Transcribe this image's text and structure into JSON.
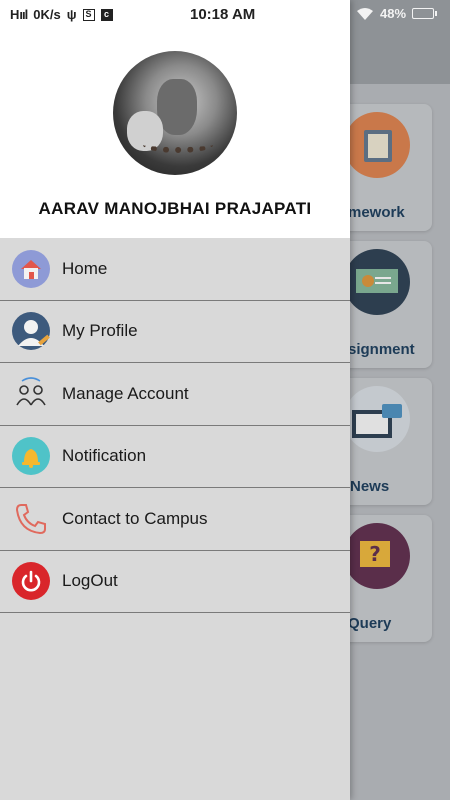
{
  "status_bar": {
    "network_speed": "0K/s",
    "time": "10:18 AM",
    "battery_level": "48%"
  },
  "user": {
    "name": "AARAV MANOJBHAI PRAJAPATI"
  },
  "menu": {
    "items": [
      {
        "label": "Home",
        "icon": "home-icon"
      },
      {
        "label": "My Profile",
        "icon": "profile-icon"
      },
      {
        "label": "Manage Account",
        "icon": "manage-account-icon"
      },
      {
        "label": "Notification",
        "icon": "bell-icon"
      },
      {
        "label": "Contact to Campus",
        "icon": "phone-icon"
      },
      {
        "label": "LogOut",
        "icon": "power-icon"
      }
    ]
  },
  "background_cards": [
    {
      "label": "mework",
      "icon": "notebook-icon"
    },
    {
      "label": "signment",
      "icon": "presentation-icon"
    },
    {
      "label": "News",
      "icon": "news-icon"
    },
    {
      "label": "Query",
      "icon": "question-icon"
    }
  ],
  "colors": {
    "drawer_bg": "#d9d9d9",
    "header_bg": "#ffffff",
    "card_label": "#1d3b57"
  }
}
